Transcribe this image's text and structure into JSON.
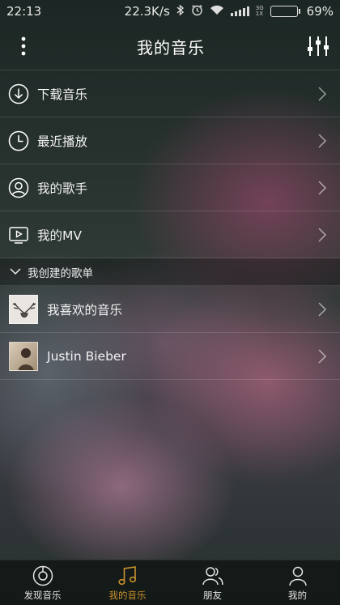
{
  "status_bar": {
    "time": "22:13",
    "net_speed": "22.3K/s",
    "net_type_top": "3G",
    "net_type_bottom": "1X",
    "battery_percent": "69%",
    "battery_level": 0.69,
    "icons": [
      "bluetooth-icon",
      "alarm-icon",
      "wifi-icon",
      "signal-icon",
      "battery-icon"
    ]
  },
  "header": {
    "title": "我的音乐",
    "left_icon": "more-vertical-icon",
    "right_icon": "equalizer-icon"
  },
  "menu": {
    "items": [
      {
        "label": "下载音乐",
        "icon": "download-icon"
      },
      {
        "label": "最近播放",
        "icon": "clock-icon"
      },
      {
        "label": "我的歌手",
        "icon": "singer-icon"
      },
      {
        "label": "我的MV",
        "icon": "mv-icon"
      }
    ]
  },
  "playlists": {
    "section_title": "我创建的歌单",
    "items": [
      {
        "label": "我喜欢的音乐",
        "cover": "antlers-cover"
      },
      {
        "label": "Justin Bieber",
        "cover": "artist-cover"
      }
    ]
  },
  "bottom_nav": {
    "tabs": [
      {
        "label": "发现音乐",
        "icon": "discover-icon",
        "active": false
      },
      {
        "label": "我的音乐",
        "icon": "music-note-icon",
        "active": true
      },
      {
        "label": "朋友",
        "icon": "friends-icon",
        "active": false
      },
      {
        "label": "我的",
        "icon": "profile-icon",
        "active": false
      }
    ]
  },
  "colors": {
    "accent": "#c8912d",
    "battery": "#5ec84a"
  }
}
